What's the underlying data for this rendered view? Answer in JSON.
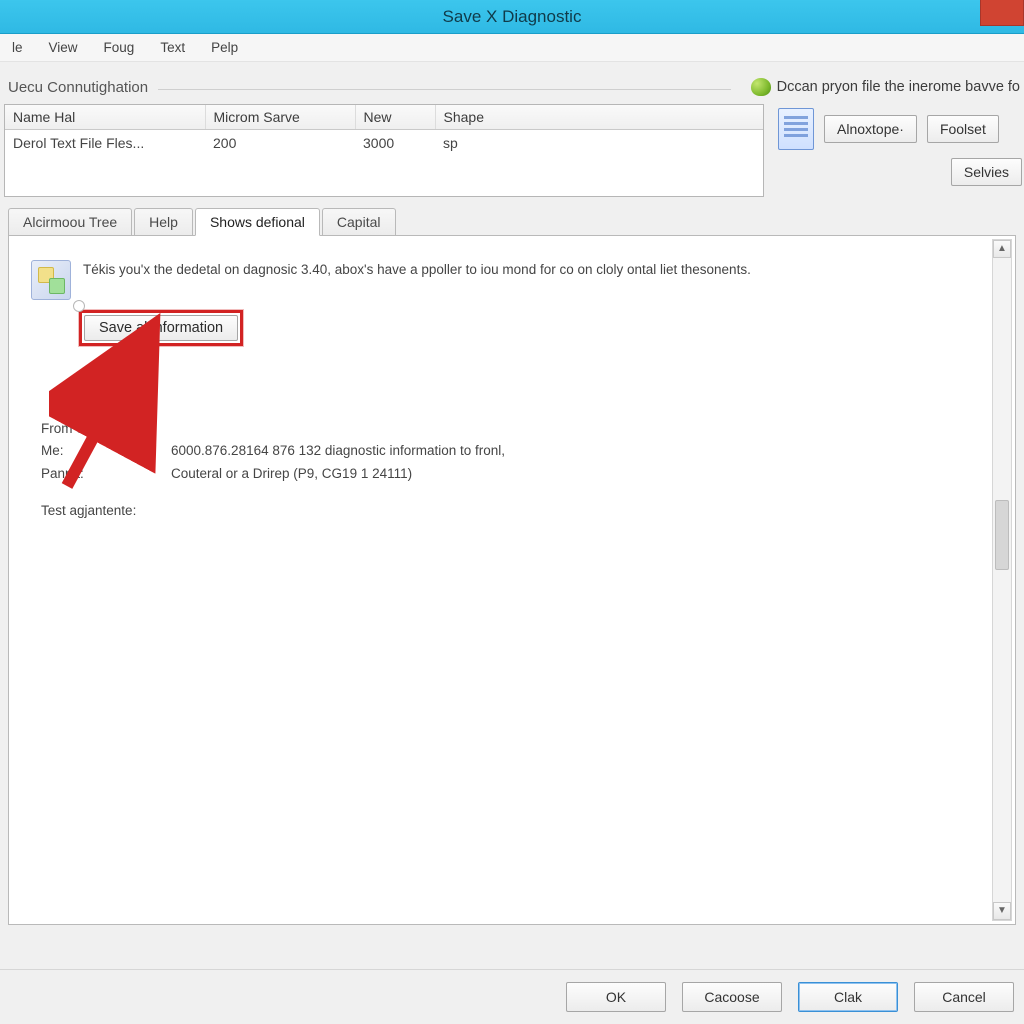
{
  "window": {
    "title": "Save X Diagnostic"
  },
  "menu": {
    "items": [
      "le",
      "View",
      "Foug",
      "Text",
      "Pelp"
    ]
  },
  "section": {
    "label": "Uecu Connutighation",
    "right_text": "Dccan pryon file the inerome bavve fo"
  },
  "table": {
    "headers": [
      "Name Hal",
      "Microm Sarve",
      "New",
      "Shape"
    ],
    "rows": [
      [
        "Derol Text File Fles...",
        "200",
        "3000",
        "sp"
      ]
    ]
  },
  "side": {
    "btn1": "Alnoxtope·",
    "btn2": "Foolset",
    "btn3": "Selvies"
  },
  "tabs": {
    "items": [
      "Alcirmoou Tree",
      "Help",
      "Shows defional",
      "Capital"
    ],
    "active_index": 2
  },
  "content": {
    "intro": "Tékis you'x the dedetal on dagnosic 3.40, abox's have a ppoller to iou mond for co on cloly ontal liet thesonents.",
    "save_all_label": "Save al information",
    "from_label": "From Saspa:",
    "me_label": "Me:",
    "me_value": "6000.876.28164 876 132 diagnostic information to fronl,",
    "panpa_label": "Panpa:",
    "panpa_value": "Couteral or a Drirep (P9, CG19 1 24111)",
    "test_label": "Test agjantente:"
  },
  "footer": {
    "ok": "OK",
    "cacoose": "Cacoose",
    "clak": "Clak",
    "cancel": "Cancel"
  }
}
